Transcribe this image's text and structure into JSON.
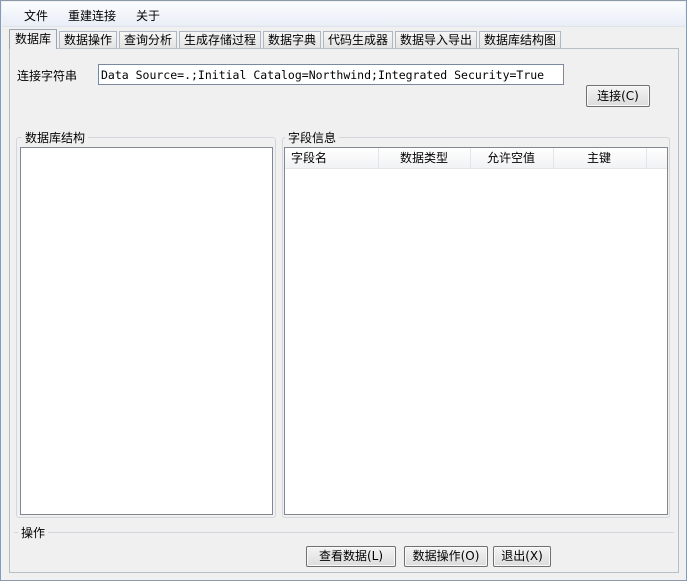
{
  "menu": {
    "items": [
      {
        "label": "文件"
      },
      {
        "label": "重建连接"
      },
      {
        "label": "关于"
      }
    ]
  },
  "tabs": [
    {
      "label": "数据库",
      "active": true
    },
    {
      "label": "数据操作"
    },
    {
      "label": "查询分析"
    },
    {
      "label": "生成存储过程"
    },
    {
      "label": "数据字典"
    },
    {
      "label": "代码生成器"
    },
    {
      "label": "数据导入导出"
    },
    {
      "label": "数据库结构图"
    }
  ],
  "connection": {
    "label": "连接字符串",
    "value": "Data Source=.;Initial Catalog=Northwind;Integrated Security=True",
    "connect_button": "连接(C)"
  },
  "db_structure": {
    "title": "数据库结构"
  },
  "field_info": {
    "title": "字段信息",
    "columns": [
      "字段名",
      "数据类型",
      "允许空值",
      "主键"
    ]
  },
  "operations": {
    "title": "操作",
    "view_data_button": "查看数据(L)",
    "data_ops_button": "数据操作(O)",
    "exit_button": "退出(X)"
  }
}
